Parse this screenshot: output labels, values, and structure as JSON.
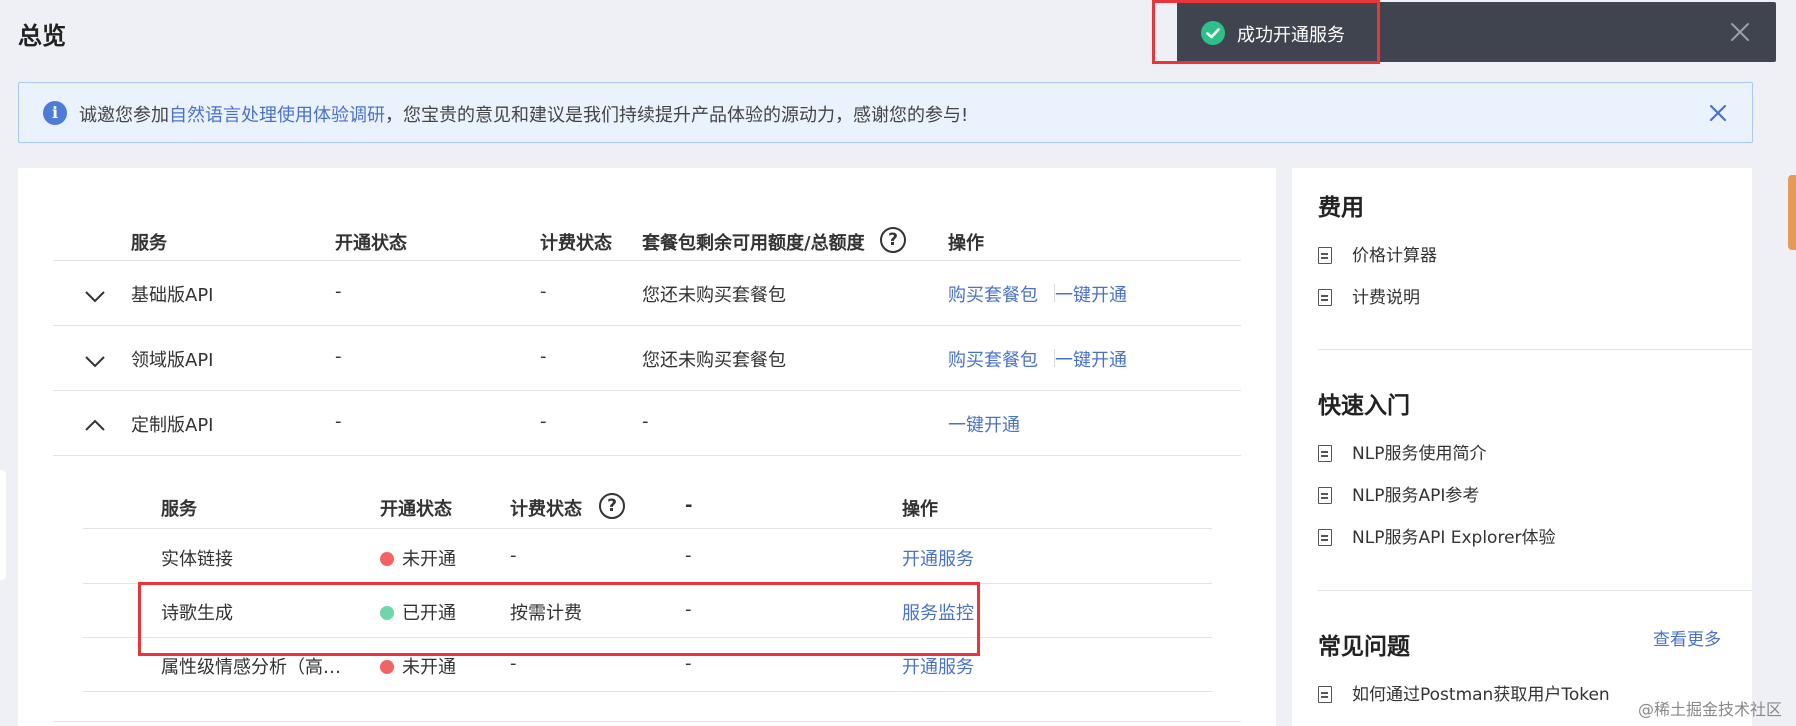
{
  "page": {
    "title": "总览"
  },
  "toast": {
    "message": "成功开通服务",
    "icon": "check-circle-icon",
    "close_icon": "close-icon",
    "color_success": "#2fc089"
  },
  "banner": {
    "prefix": "诚邀您参加",
    "link": "自然语言处理使用体验调研",
    "suffix": "，您宝贵的意见和建议是我们持续提升产品体验的源动力，感谢您的参与!"
  },
  "services_table": {
    "headers": {
      "service": "服务",
      "status": "开通状态",
      "billing": "计费状态",
      "quota": "套餐包剩余可用额度/总额度",
      "actions": "操作"
    },
    "rows": [
      {
        "name": "基础版API",
        "status": "-",
        "billing": "-",
        "quota": "您还未购买套餐包",
        "action_buy": "购买套餐包",
        "action_open": "一键开通",
        "expanded": false
      },
      {
        "name": "领域版API",
        "status": "-",
        "billing": "-",
        "quota": "您还未购买套餐包",
        "action_buy": "购买套餐包",
        "action_open": "一键开通",
        "expanded": false
      },
      {
        "name": "定制版API",
        "status": "-",
        "billing": "-",
        "quota": "-",
        "action_open": "一键开通",
        "expanded": true
      }
    ]
  },
  "sub_table": {
    "headers": {
      "service": "服务",
      "status": "开通状态",
      "billing": "计费状态",
      "extra": "-",
      "actions": "操作"
    },
    "rows": [
      {
        "name": "实体链接",
        "status": "未开通",
        "billing": "-",
        "extra": "-",
        "action": "开通服务"
      },
      {
        "name": "诗歌生成",
        "status": "已开通",
        "billing": "按需计费",
        "extra": "-",
        "action": "服务监控"
      },
      {
        "name": "属性级情感分析（高…",
        "status": "未开通",
        "billing": "-",
        "extra": "-",
        "action": "开通服务"
      }
    ]
  },
  "sidebar": {
    "fees": {
      "title": "费用",
      "items": [
        "价格计算器",
        "计费说明"
      ]
    },
    "quickstart": {
      "title": "快速入门",
      "items": [
        "NLP服务使用简介",
        "NLP服务API参考",
        "NLP服务API Explorer体验"
      ]
    },
    "faq": {
      "title": "常见问题",
      "more": "查看更多",
      "items": [
        "如何通过Postman获取用户Token"
      ]
    }
  },
  "watermark": "@稀土掘金技术社区",
  "colors": {
    "link": "#4a72c9",
    "status_off": "#f26464",
    "status_on": "#6fd6ac",
    "highlight": "#e8353a"
  }
}
